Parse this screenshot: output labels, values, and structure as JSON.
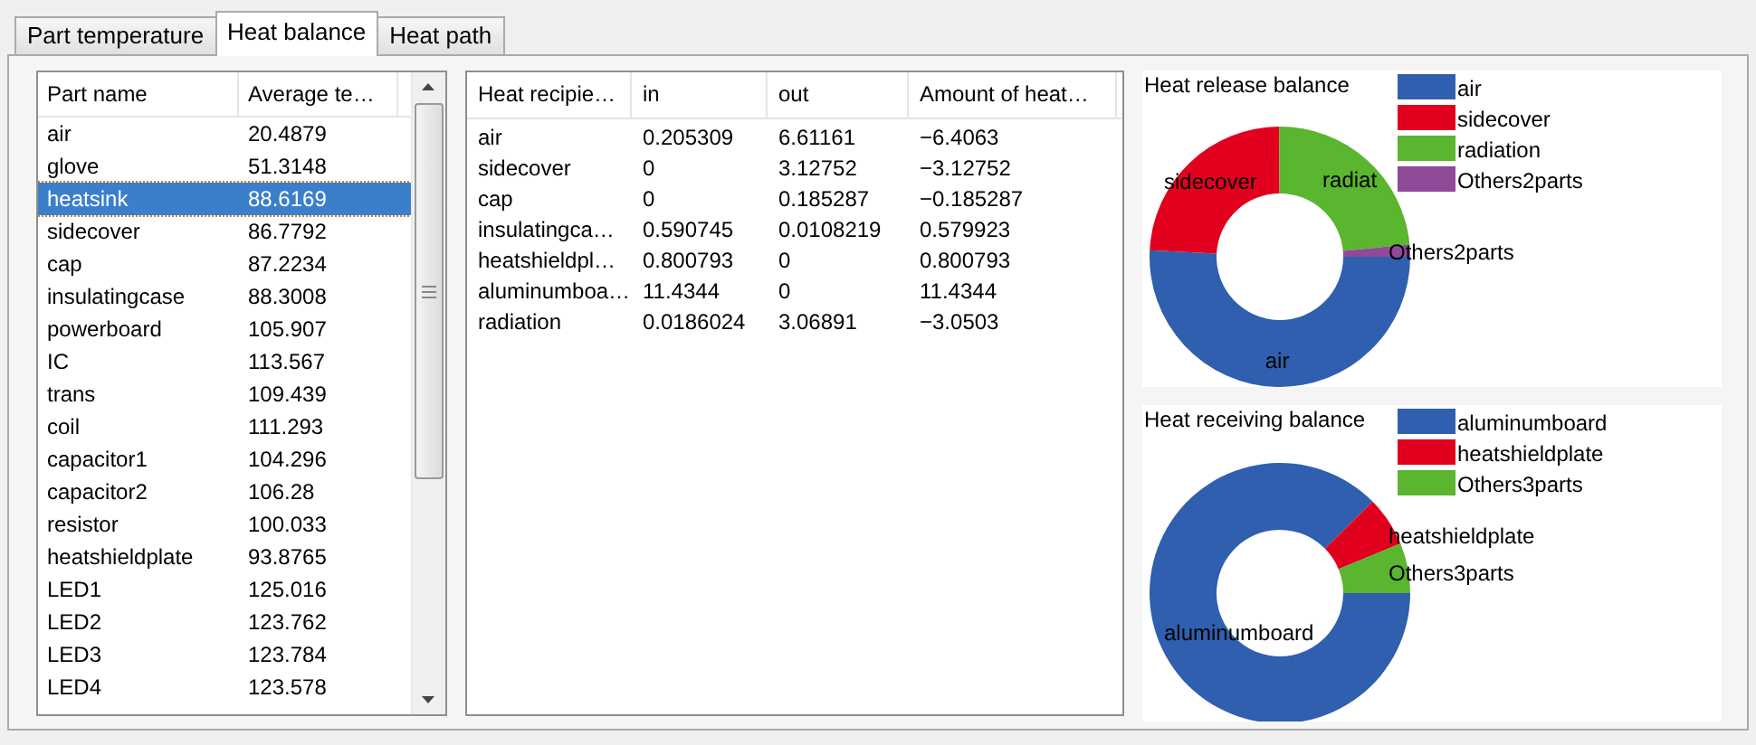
{
  "tabs": [
    {
      "label": "Part temperature",
      "selected": false
    },
    {
      "label": "Heat balance",
      "selected": true
    },
    {
      "label": "Heat path",
      "selected": false
    }
  ],
  "parts": {
    "columns": [
      "Part name",
      "Average te…"
    ],
    "rows": [
      {
        "name": "air",
        "value": "20.4879",
        "selected": false
      },
      {
        "name": "glove",
        "value": "51.3148",
        "selected": false
      },
      {
        "name": "heatsink",
        "value": "88.6169",
        "selected": true
      },
      {
        "name": "sidecover",
        "value": "86.7792",
        "selected": false
      },
      {
        "name": "cap",
        "value": "87.2234",
        "selected": false
      },
      {
        "name": "insulatingcase",
        "value": "88.3008",
        "selected": false
      },
      {
        "name": "powerboard",
        "value": "105.907",
        "selected": false
      },
      {
        "name": "IC",
        "value": "113.567",
        "selected": false
      },
      {
        "name": "trans",
        "value": "109.439",
        "selected": false
      },
      {
        "name": "coil",
        "value": "111.293",
        "selected": false
      },
      {
        "name": "capacitor1",
        "value": "104.296",
        "selected": false
      },
      {
        "name": "capacitor2",
        "value": "106.28",
        "selected": false
      },
      {
        "name": "resistor",
        "value": "100.033",
        "selected": false
      },
      {
        "name": "heatshieldplate",
        "value": "93.8765",
        "selected": false
      },
      {
        "name": "LED1",
        "value": "125.016",
        "selected": false
      },
      {
        "name": "LED2",
        "value": "123.762",
        "selected": false
      },
      {
        "name": "LED3",
        "value": "123.784",
        "selected": false
      },
      {
        "name": "LED4",
        "value": "123.578",
        "selected": false
      }
    ]
  },
  "heat_table": {
    "columns": [
      "Heat recipie…",
      "in",
      "out",
      "Amount of heat…"
    ],
    "rows": [
      [
        "air",
        "0.205309",
        "6.61161",
        "−6.4063"
      ],
      [
        "sidecover",
        "0",
        "3.12752",
        "−3.12752"
      ],
      [
        "cap",
        "0",
        "0.185287",
        "−0.185287"
      ],
      [
        "insulatingca…",
        "0.590745",
        "0.0108219",
        "0.579923"
      ],
      [
        "heatshieldpl…",
        "0.800793",
        "0",
        "0.800793"
      ],
      [
        "aluminumboa…",
        "11.4344",
        "0",
        "11.4344"
      ],
      [
        "radiation",
        "0.0186024",
        "3.06891",
        "−3.0503"
      ]
    ]
  },
  "charts": [
    {
      "title": "Heat release balance",
      "slice_labels": [
        "air",
        "sidecover",
        "radiat",
        "Others2parts"
      ],
      "chart_data": {
        "type": "donut",
        "legend": "top-right",
        "categories": [
          "air",
          "sidecover",
          "radiation",
          "Others2parts"
        ],
        "colors": [
          "#2f5fae",
          "#e2001f",
          "#5ab52f",
          "#8f4a98"
        ],
        "values": [
          50.8,
          24.1,
          23.6,
          1.5
        ]
      }
    },
    {
      "title": "Heat receiving balance",
      "slice_labels": [
        "aluminumboard",
        "heatshieldplate",
        "Others3parts"
      ],
      "chart_data": {
        "type": "donut",
        "legend": "top-right",
        "categories": [
          "aluminumboard",
          "heatshieldplate",
          "Others3parts"
        ],
        "colors": [
          "#2f5fae",
          "#e2001f",
          "#5ab52f"
        ],
        "values": [
          87.6,
          6.2,
          6.2
        ]
      }
    }
  ]
}
